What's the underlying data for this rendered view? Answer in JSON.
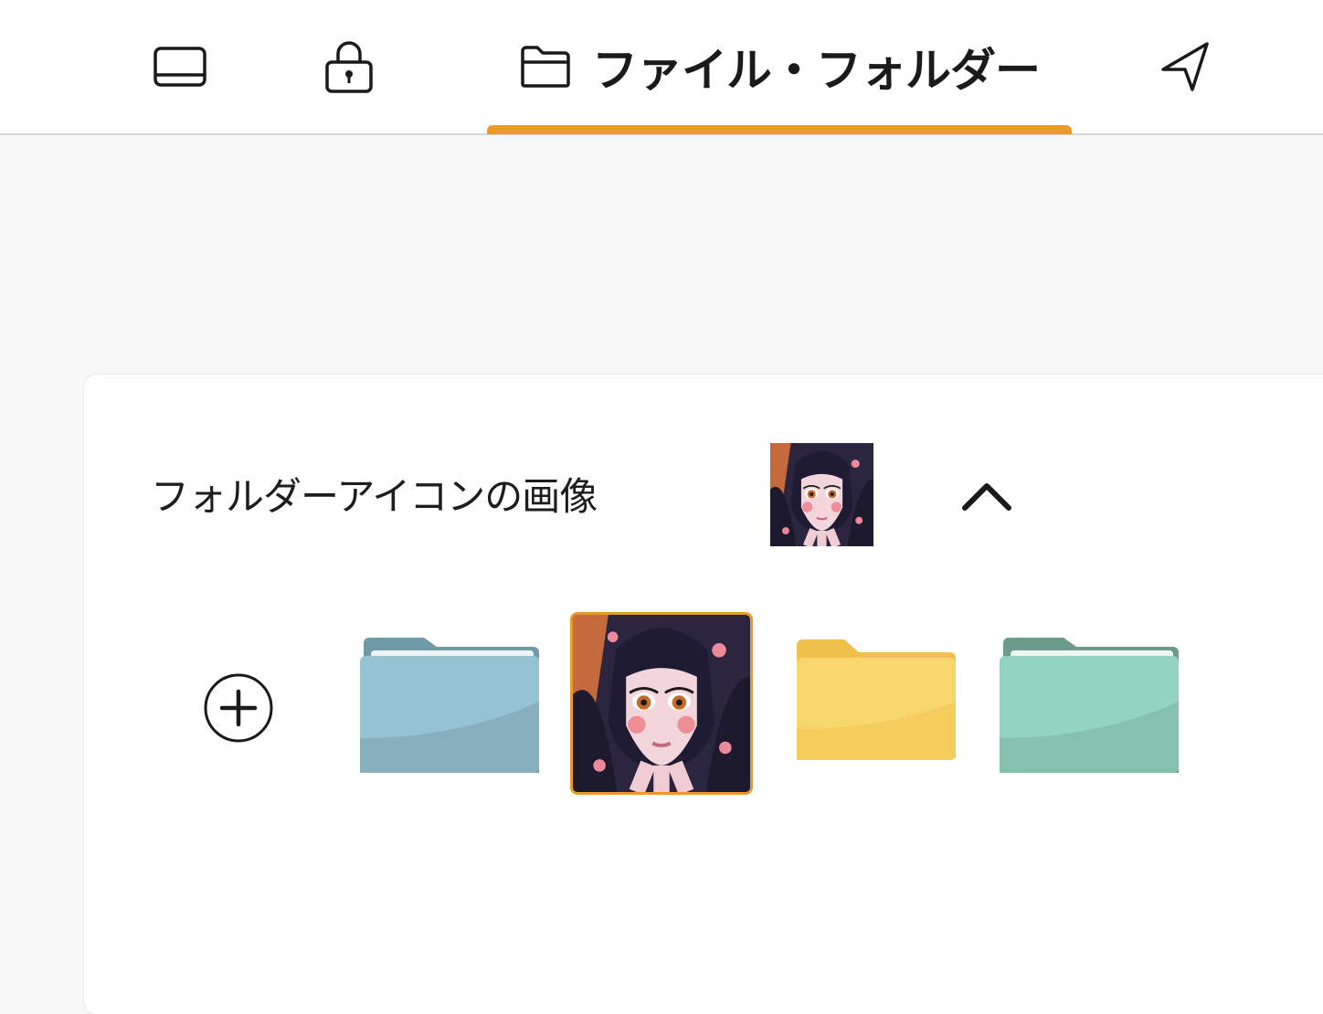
{
  "tabs": {
    "device": {
      "icon": "laptop-icon"
    },
    "lock": {
      "icon": "lock-icon"
    },
    "files": {
      "icon": "folder-icon",
      "label": "ファイル・フォルダー",
      "selected": true
    },
    "send": {
      "icon": "send-icon"
    }
  },
  "colors": {
    "accent": "#e89b2a",
    "folder_blue": "#96c3d2",
    "folder_yellow": "#f8d66e",
    "folder_teal": "#92d4c1"
  },
  "folder_icon_section": {
    "title": "フォルダーアイコンの画像",
    "preview_icon": "custom-portrait-image",
    "collapse_icon": "chevron-up-icon",
    "add_icon": "plus-circle-icon",
    "options": [
      {
        "name": "blue-folder",
        "icon": "folder-icon",
        "selected": false
      },
      {
        "name": "custom-portrait",
        "icon": "portrait-image",
        "selected": true
      },
      {
        "name": "yellow-folder",
        "icon": "folder-icon",
        "selected": false
      },
      {
        "name": "teal-folder",
        "icon": "folder-icon",
        "selected": false
      }
    ]
  }
}
